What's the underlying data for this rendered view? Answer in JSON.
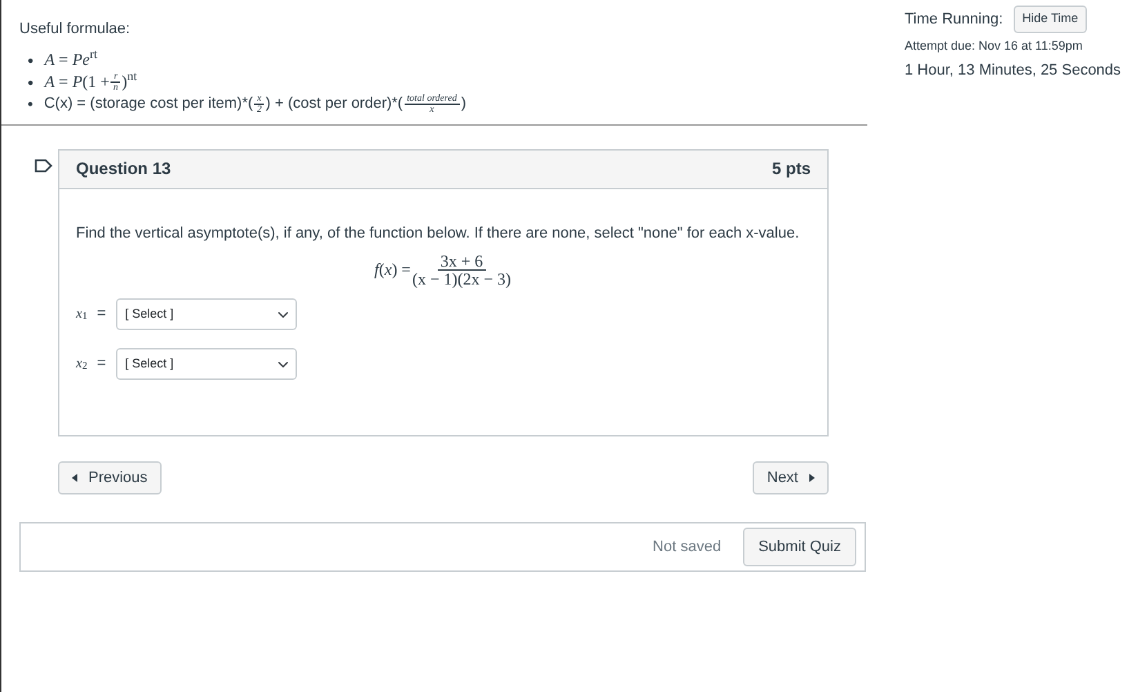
{
  "formulae": {
    "heading": "Useful formulae:",
    "items": [
      {
        "bullet": "•",
        "parts": [
          {
            "kind": "text",
            "text": "*A* = *Pe*$^{rt}$"
          }
        ]
      },
      {
        "bullet": "•",
        "parts": [
          {
            "kind": "text",
            "text": "*A* = *P*(1 + "
          },
          {
            "kind": "frac",
            "num": "r",
            "den": "n"
          },
          {
            "kind": "text",
            "text": ")$^{nt}$"
          }
        ]
      },
      {
        "bullet": "•",
        "parts": [
          {
            "kind": "text",
            "text": "C(x) = (storage cost per item)*("
          },
          {
            "kind": "frac",
            "num": "x",
            "den": "2"
          },
          {
            "kind": "text",
            "text": ") + (cost per order)*("
          },
          {
            "kind": "frac",
            "num": "total ordered",
            "den": "x"
          },
          {
            "kind": "text",
            "text": ")"
          }
        ]
      }
    ]
  },
  "question": {
    "flagged": false,
    "title": "Question 13",
    "points": "5 pts",
    "prompt": "Find the vertical asymptote(s), if any, of the function below.  If there are none, select \"none\" for each x-value.",
    "function": [
      {
        "kind": "text",
        "text": "*f*(*x*) = "
      },
      {
        "kind": "frac",
        "num": "3x + 6",
        "den": "(x − 1)(2x − 3)"
      }
    ],
    "answers": [
      {
        "label": "*x*$_{1}$",
        "equals": "=",
        "value": "[ Select ]"
      },
      {
        "label": "*x*$_{2}$",
        "equals": "=",
        "value": "[ Select ]"
      }
    ]
  },
  "nav": {
    "previous": "Previous",
    "next": "Next"
  },
  "footer": {
    "status": "Not saved",
    "submit": "Submit Quiz"
  },
  "sidebar": {
    "time_label": "Time Running:",
    "hide_button": "Hide Time",
    "due": "Attempt due: Nov 16 at 11:59pm",
    "elapsed": "1 Hour, 13 Minutes, 25 Seconds"
  }
}
